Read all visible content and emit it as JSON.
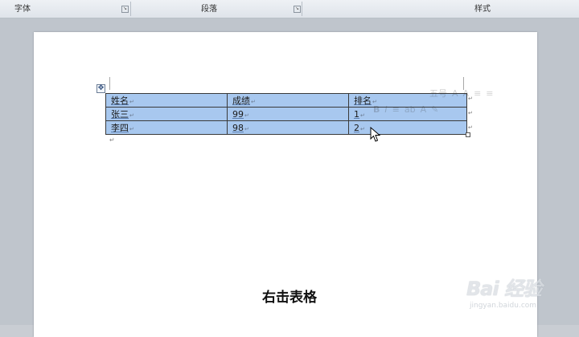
{
  "ribbon": {
    "groups": [
      {
        "label": "字体"
      },
      {
        "label": "段落"
      },
      {
        "label": "样式"
      }
    ],
    "launcher_glyph": "↘"
  },
  "table": {
    "rows": [
      {
        "cells": [
          "姓名",
          "成绩",
          "排名"
        ]
      },
      {
        "cells": [
          "张三",
          "99",
          "1"
        ]
      },
      {
        "cells": [
          "李四",
          "98",
          "2"
        ]
      }
    ],
    "cell_mark": "↵",
    "move_handle_glyph": "✥"
  },
  "mini_toolbar": {
    "row1": [
      "五号",
      "A",
      "A",
      "≡",
      "≡"
    ],
    "row2": [
      "B",
      "I",
      "≡",
      "ab",
      "A",
      "✎"
    ]
  },
  "subtitle": "右击表格",
  "watermark": {
    "brand": "Bai 经验",
    "url": "jingyan.baidu.com"
  },
  "colors": {
    "selection": "#a8c8ef",
    "ribbon_bg": "#e6eaef",
    "canvas_bg": "#bfc5cc"
  }
}
